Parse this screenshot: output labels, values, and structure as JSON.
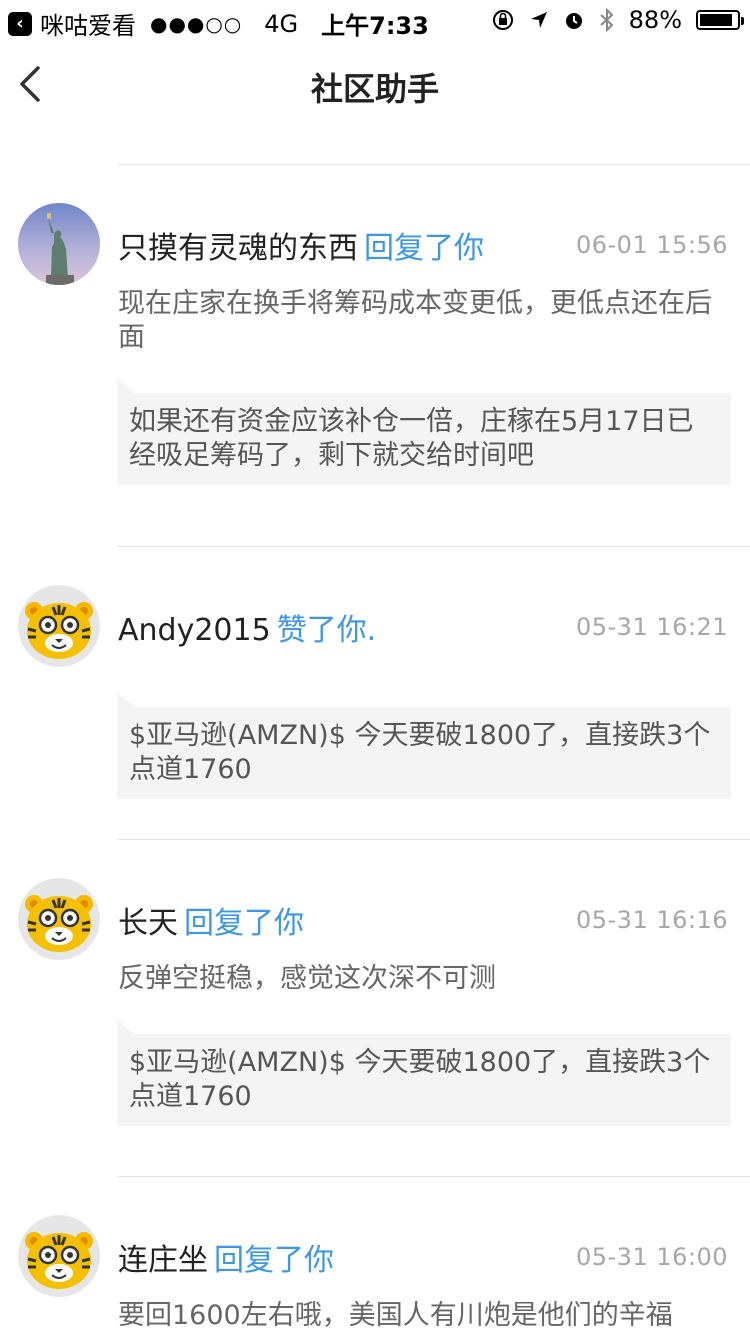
{
  "status": {
    "back_app": "咪咕爱看",
    "signal": "●●●○○",
    "network": "4G",
    "time": "上午7:33",
    "battery": "88%"
  },
  "nav": {
    "title": "社区助手"
  },
  "colors": {
    "accent": "#3d97e8",
    "divider": "#e5e5e5",
    "quote_bg": "#f4f4f4"
  },
  "notifications": [
    {
      "avatar": "statue-of-liberty-avatar",
      "name": "只摸有灵魂的东西",
      "action": "回复了你",
      "time": "06-01 15:56",
      "message": "现在庄家在换手将筹码成本变更低，更低点还在后面",
      "quote": "如果还有资金应该补仓一倍，庄稼在5月17日已经吸足筹码了，剩下就交给时间吧"
    },
    {
      "avatar": "tiger-avatar",
      "name": "Andy2015",
      "action": "赞了你.",
      "time": "05-31 16:21",
      "message": "",
      "quote": "$亚马逊(AMZN)$ 今天要破1800了，直接跌3个点道1760"
    },
    {
      "avatar": "tiger-avatar",
      "name": "长天",
      "action": "回复了你",
      "time": "05-31 16:16",
      "message": "反弹空挺稳，感觉这次深不可测",
      "quote": "$亚马逊(AMZN)$ 今天要破1800了，直接跌3个点道1760"
    },
    {
      "avatar": "tiger-avatar",
      "name": "连庄坐",
      "action": "回复了你",
      "time": "05-31 16:00",
      "message": "要回1600左右哦，美国人有川炮是他们的辛福",
      "quote": ""
    }
  ]
}
